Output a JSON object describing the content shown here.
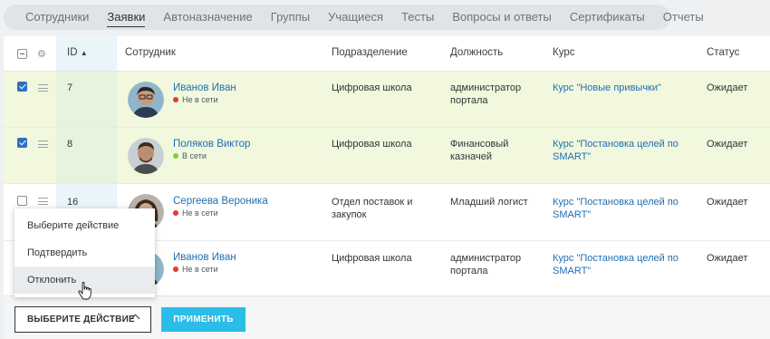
{
  "tabs": [
    {
      "label": "Сотрудники",
      "active": false
    },
    {
      "label": "Заявки",
      "active": true
    },
    {
      "label": "Автоназначение",
      "active": false
    },
    {
      "label": "Группы",
      "active": false
    },
    {
      "label": "Учащиеся",
      "active": false
    },
    {
      "label": "Тесты",
      "active": false
    },
    {
      "label": "Вопросы и ответы",
      "active": false
    },
    {
      "label": "Сертификаты",
      "active": false
    },
    {
      "label": "Отчеты",
      "active": false
    }
  ],
  "table": {
    "headers": {
      "id": "ID",
      "employee": "Сотрудник",
      "department": "Подразделение",
      "position": "Должность",
      "course": "Курс",
      "status": "Статус"
    },
    "sort_indicator": "▲",
    "rows": [
      {
        "selected": true,
        "id": "7",
        "name": "Иванов Иван",
        "presence": "Не в сети",
        "presence_color": "#e03a2f",
        "department": "Цифровая школа",
        "position": "администратор портала",
        "course": "Курс \"Новые привычки\"",
        "status": "Ожидает"
      },
      {
        "selected": true,
        "id": "8",
        "name": "Поляков Виктор",
        "presence": "В сети",
        "presence_color": "#8ccc2d",
        "department": "Цифровая школа",
        "position": "Финансовый казначей",
        "course": "Курс \"Постановка целей по SMART\"",
        "status": "Ожидает"
      },
      {
        "selected": false,
        "id": "16",
        "name": "Сергеева Вероника",
        "presence": "Не в сети",
        "presence_color": "#e03a2f",
        "department": "Отдел поставок и закупок",
        "position": "Младший логист",
        "course": "Курс \"Постановка целей по SMART\"",
        "status": "Ожидает"
      },
      {
        "selected": false,
        "id": "",
        "name": "Иванов Иван",
        "presence": "Не в сети",
        "presence_color": "#e03a2f",
        "department": "Цифровая школа",
        "position": "администратор портала",
        "course": "Курс \"Постановка целей по SMART\"",
        "status": "Ожидает"
      }
    ]
  },
  "action_menu": {
    "items": [
      "Выберите действие",
      "Подтвердить",
      "Отклонить"
    ],
    "hovered_index": 2
  },
  "bottom_bar": {
    "select_label": "ВЫБЕРИТЕ ДЕЙСТВИЕ",
    "apply_label": "ПРИМЕНИТЬ"
  },
  "icons": {
    "settings": "gear-icon",
    "drag": "drag-handle-icon",
    "chevron": "chevron-up-icon",
    "cursor": "hand-pointer-icon"
  },
  "colors": {
    "accent": "#29bde8",
    "link": "#1f6fb2",
    "selected_row": "#f1f8dd",
    "offline": "#e03a2f",
    "online": "#8ccc2d"
  }
}
